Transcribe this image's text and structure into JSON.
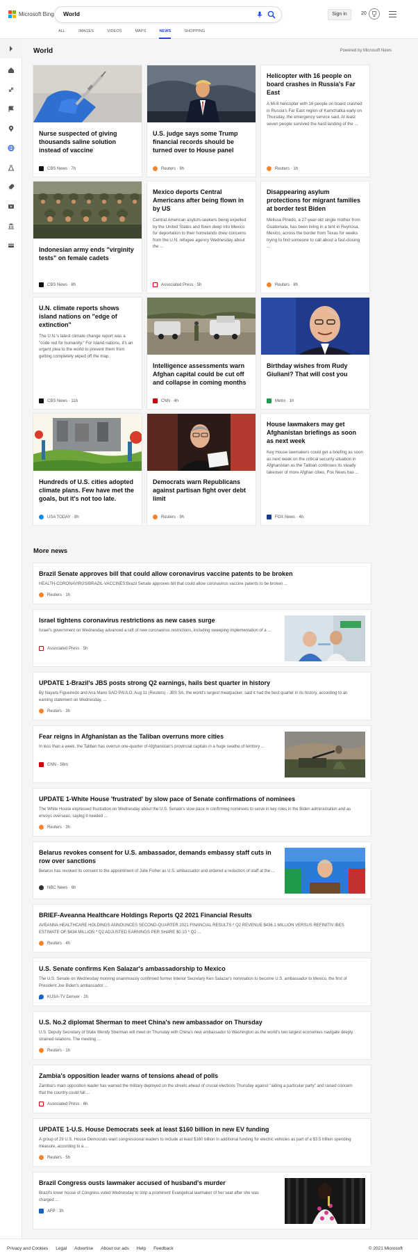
{
  "brand": {
    "name": "Microsoft Bing",
    "colors": [
      "#f25022",
      "#7fba00",
      "#00a4ef",
      "#ffb900"
    ]
  },
  "search": {
    "query": "World"
  },
  "header": {
    "signin": "Sign in",
    "points": "20"
  },
  "scopes": [
    "ALL",
    "IMAGES",
    "VIDEOS",
    "MAPS",
    "NEWS",
    "SHOPPING"
  ],
  "active_scope": "NEWS",
  "rail_icons": [
    "expand-icon",
    "home-icon",
    "sports-icon",
    "flag-icon",
    "location-icon",
    "globe-icon",
    "science-icon",
    "rocket-icon",
    "video-icon",
    "bank-icon",
    "card-icon"
  ],
  "section": {
    "title": "World",
    "powered_by": "Powered by Microsoft News"
  },
  "cards": [
    {
      "title": "Nurse suspected of giving thousands saline solution instead of vaccine",
      "snippet": "",
      "source": "CBS News",
      "time": "7h",
      "src_color": "#111"
    },
    {
      "title": "U.S. judge says some Trump financial records should be turned over to House panel",
      "snippet": "",
      "source": "Reuters",
      "time": "9h",
      "src_color": "#f3852e"
    },
    {
      "title": "Helicopter with 16 people on board crashes in Russia's Far East",
      "snippet": "A Mi-8 helicopter with 16 people on board crashed in Russia's Far East region of Kamchatka early on Thursday, the emergency service said. At least seven people survived the hard landing of the ...",
      "source": "Reuters",
      "time": "1h",
      "src_color": "#f3852e"
    },
    {
      "title": "Indonesian army ends \"virginity tests\" on female cadets",
      "snippet": "",
      "source": "CBS News",
      "time": "8h",
      "src_color": "#111"
    },
    {
      "title": "Mexico deports Central Americans after being flown in by US",
      "snippet": "Central American asylum-seekers being expelled by the United States and flown deep into Mexico for deportation to their homelands drew concerns from the U.N. refugee agency Wednesday about the ...",
      "source": "Associated Press",
      "time": "5h",
      "src_color": "#c00"
    },
    {
      "title": "Disappearing asylum protections for migrant families at border test Biden",
      "snippet": "Melissa Pinedo, a 27-year-old single mother from Guatemala, has been living in a tent in Reynosa, Mexico, across the border from Texas for weeks trying to find someone to call about a fast-closing ...",
      "source": "Reuters",
      "time": "8h",
      "src_color": "#f3852e"
    },
    {
      "title": "U.N. climate reports shows island nations on \"edge of extinction\"",
      "snippet": "The U.N.'s latest climate change report was a \"code red for humanity.\" For island nations, it's an urgent plea to the world to prevent them from getting completely wiped off the map.",
      "source": "CBS News",
      "time": "11h",
      "src_color": "#111"
    },
    {
      "title": "Intelligence assessments warn Afghan capital could be cut off and collapse in coming months",
      "snippet": "",
      "source": "CNN",
      "time": "4h",
      "src_color": "#cc0000"
    },
    {
      "title": "Birthday wishes from Rudy Giuliani? That will cost you",
      "snippet": "",
      "source": "Metro",
      "time": "1h",
      "src_color": "#1a9c4a"
    },
    {
      "title": "Hundreds of U.S. cities adopted climate plans. Few have met the goals, but it's not too late.",
      "snippet": "",
      "source": "USA TODAY",
      "time": "8h",
      "src_color": "#1e88e5"
    },
    {
      "title": "Democrats warn Republicans against partisan fight over debt limit",
      "snippet": "",
      "source": "Reuters",
      "time": "9h",
      "src_color": "#f3852e"
    },
    {
      "title": "House lawmakers may get Afghanistan briefings as soon as next week",
      "snippet": "Key House lawmakers could get a briefing as soon as next week on the critical security situation in Afghanistan as the Taliban continues its steady takeover of more Afghan cities, Fox News has ...",
      "source": "FOX News",
      "time": "4h",
      "src_color": "#1a3a8a"
    }
  ],
  "more_news_title": "More news",
  "more_news": [
    {
      "title": "Brazil Senate approves bill that could allow coronavirus vaccine patents to be broken",
      "snippet": "HEALTH-CORONAVIRUS/BRAZIL-VACCINES:Brazil Senate approves bill that could allow coronavirus vaccine patents to be broken ...",
      "source": "Reuters",
      "time": "1h",
      "src_color": "#f3852e"
    },
    {
      "title": "Israel tightens coronavirus restrictions as new cases surge",
      "snippet": "Israel's government on Wednesday advanced a raft of new coronavirus restrictions, including sweeping implementation of a ...",
      "source": "Associated Press",
      "time": "5h",
      "src_color": "#c00"
    },
    {
      "title": "UPDATE 1-Brazil's JBS posts strong Q2 earnings, hails best quarter in history",
      "snippet": "By Nayara Figueiredo and Ana Mano SAO PAULO, Aug 11 (Reuters) - JBS SA, the world's largest meatpacker, said it had the best quarter in its history, according to an earning statement on Wednesday, ...",
      "source": "Reuters",
      "time": "3h",
      "src_color": "#f3852e"
    },
    {
      "title": "Fear reigns in Afghanistan as the Taliban overruns more cities",
      "snippet": "In less than a week, the Taliban has overrun one-quarter of Afghanistan's provincial capitals in a huge swathe of territory ...",
      "source": "CNN",
      "time": "56m",
      "src_color": "#cc0000"
    },
    {
      "title": "UPDATE 1-White House 'frustrated' by slow pace of Senate confirmations of nominees",
      "snippet": "The White House expressed frustration on Wednesday about the U.S. Senate's slow pace in confirming nominees to serve in key roles in the Biden administration and as envoys overseas, saying it needed ...",
      "source": "Reuters",
      "time": "3h",
      "src_color": "#f3852e"
    },
    {
      "title": "Belarus revokes consent for U.S. ambassador, demands embassy staff cuts in row over sanctions",
      "snippet": "Belarus has revoked its consent to the appointment of Julie Fisher as U.S. ambassador and ordered a reduction of staff at the ...",
      "source": "NBC News",
      "time": "6h",
      "src_color": "#333"
    },
    {
      "title": "BRIEF-Aveanna Healthcare Holdings Reports Q2 2021 Financial Results",
      "snippet": "AVEANNA HEALTHCARE HOLDINGS ANNOUNCES SECOND-QUARTER 2021 FINANCIAL RESULTS * Q2 REVENUE $436.1 MILLION VERSUS REFINITIV IBES ESTIMATE OF $434 MILLION * Q2 ADJUSTED EARNINGS PER SHARE $0.10 * Q2 ...",
      "source": "Reuters",
      "time": "4h",
      "src_color": "#f3852e"
    },
    {
      "title": "U.S. Senate confirms Ken Salazar's ambassadorship to Mexico",
      "snippet": "The U.S. Senate on Wednesday morning unanimously confirmed former Interior Secretary Ken Salazar's nomination to become U.S. ambassador to Mexico, the first of President Joe Biden's ambassador ...",
      "source": "KUSA-TV Denver",
      "time": "2h",
      "src_color": "#1565c0"
    },
    {
      "title": "U.S. No.2 diplomat Sherman to meet China's new ambassador on Thursday",
      "snippet": "U.S. Deputy Secretary of State Wendy Sherman will meet on Thursday with China's new ambassador to Washington as the world's two largest economies navigate deeply strained relations. The meeting ...",
      "source": "Reuters",
      "time": "1h",
      "src_color": "#f3852e"
    },
    {
      "title": "Zambia's opposition leader warns of tensions ahead of polls",
      "snippet": "Zambia's main opposition leader has warned the military deployed on the streets ahead of crucial elections Thursday against \"aiding a particular party\" and raised concern that the country could fall ...",
      "source": "Associated Press",
      "time": "6h",
      "src_color": "#c00"
    },
    {
      "title": "UPDATE 1-U.S. House Democrats seek at least $160 billion in new EV funding",
      "snippet": "A group of 29 U.S. House Democrats want congressional leaders to include at least $160 billion in additional funding for electric vehicles as part of a $3.5 trillion spending measure, according to a ...",
      "source": "Reuters",
      "time": "5h",
      "src_color": "#f3852e"
    },
    {
      "title": "Brazil Congress ousts lawmaker accused of husband's murder",
      "snippet": "Brazil's lower house of Congress voted Wednesday to strip a prominent Evangelical lawmaker of her seat after she was charged ...",
      "source": "AFP",
      "time": "3h",
      "src_color": "#1565c0"
    }
  ],
  "footer": {
    "links": [
      "Privacy and Cookies",
      "Legal",
      "Advertise",
      "About our ads",
      "Help",
      "Feedback"
    ],
    "copyright": "© 2021 Microsoft"
  }
}
